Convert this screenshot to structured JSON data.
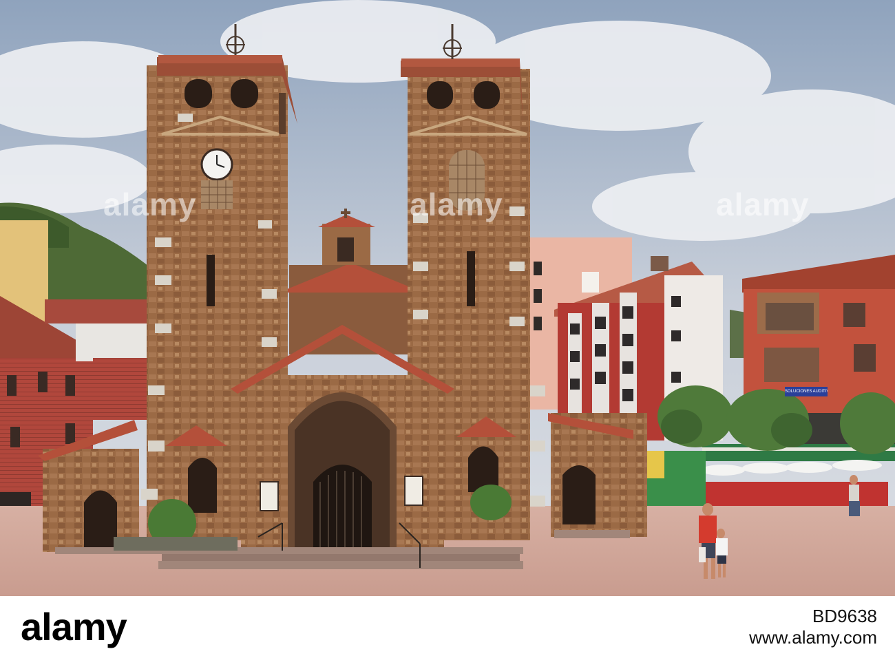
{
  "photo": {
    "subject": "stone church with two bell towers on a town square",
    "colors": {
      "sky": "#c9d0dc",
      "stone": "#9a6a45",
      "brick": "#b4413a",
      "paving": "#d8b3a6",
      "roof": "#b5513b"
    }
  },
  "watermarks": [
    "alamy",
    "alamy",
    "alamy",
    "alamy"
  ],
  "storefront_sign": "SOLUCIONES AUDITIVAS",
  "footer": {
    "logo": "alamy",
    "image_id": "BD9638",
    "url": "www.alamy.com"
  }
}
